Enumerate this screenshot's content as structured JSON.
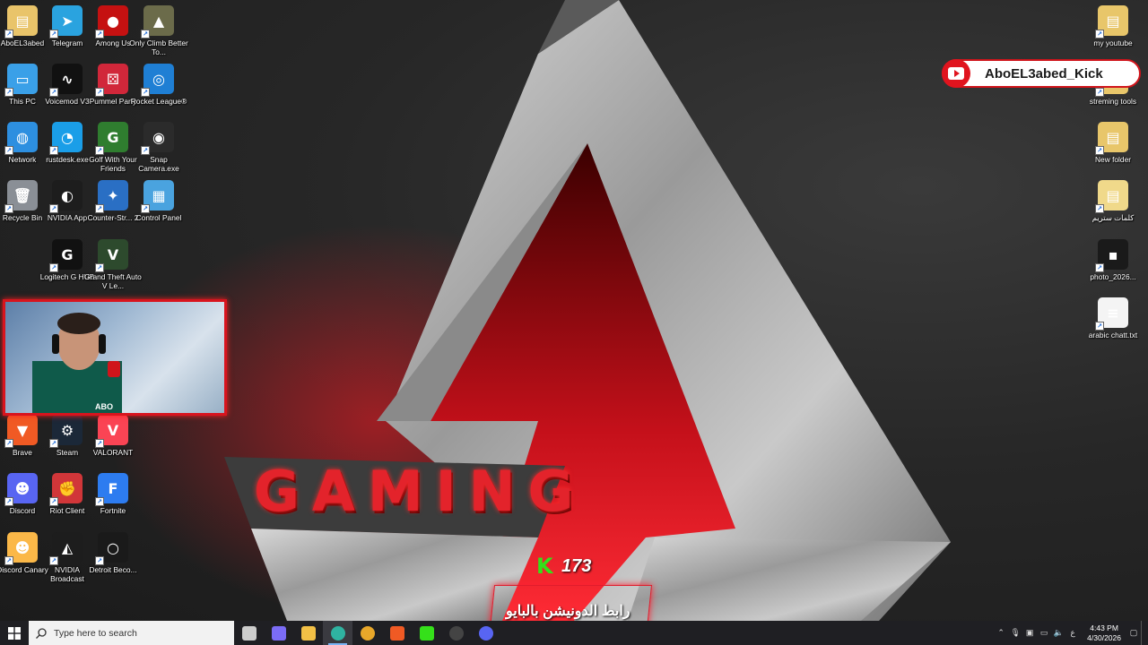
{
  "desktop_icons_left": [
    {
      "label": "AboEL3abed",
      "icon": "user-folder-icon",
      "color": "#e9c46a",
      "glyph": "▤"
    },
    {
      "label": "Telegram",
      "icon": "telegram-icon",
      "color": "#2aa3df",
      "glyph": "➤"
    },
    {
      "label": "Among Us",
      "icon": "among-us-icon",
      "color": "#c51111",
      "glyph": "●"
    },
    {
      "label": "Only Climb Better To...",
      "icon": "only-climb-icon",
      "color": "#6b6b4a",
      "glyph": "▲"
    },
    {
      "label": "This PC",
      "icon": "this-pc-icon",
      "color": "#3aa0e8",
      "glyph": "▭"
    },
    {
      "label": "Voicemod V3",
      "icon": "voicemod-icon",
      "color": "#111111",
      "glyph": "∿"
    },
    {
      "label": "Pummel Party",
      "icon": "pummel-party-icon",
      "color": "#d1273a",
      "glyph": "⚄"
    },
    {
      "label": "Rocket League®",
      "icon": "rocket-league-icon",
      "color": "#1f7fd4",
      "glyph": "◎"
    },
    {
      "label": "Network",
      "icon": "network-icon",
      "color": "#2d8fe0",
      "glyph": "◍"
    },
    {
      "label": "rustdesk.exe",
      "icon": "rustdesk-icon",
      "color": "#1a9ee8",
      "glyph": "◔"
    },
    {
      "label": "Golf With Your Friends",
      "icon": "golf-icon",
      "color": "#2f7d2f",
      "glyph": "G"
    },
    {
      "label": "Snap Camera.exe",
      "icon": "snap-camera-icon",
      "color": "#2b2b2b",
      "glyph": "◉"
    },
    {
      "label": "Recycle Bin",
      "icon": "recycle-bin-icon",
      "color": "#8a8f96",
      "glyph": "🗑"
    },
    {
      "label": "NVIDIA App",
      "icon": "nvidia-icon",
      "color": "#1d1d1d",
      "glyph": "◐"
    },
    {
      "label": "Counter-Str... 2",
      "icon": "counter-strike-icon",
      "color": "#2a6fc4",
      "glyph": "✦"
    },
    {
      "label": "Control Panel",
      "icon": "control-panel-icon",
      "color": "#4aa3df",
      "glyph": "▦"
    },
    {
      "label": "Logitech G HUB",
      "icon": "logitech-icon",
      "color": "#111111",
      "glyph": "G"
    },
    {
      "label": "Grand Theft Auto V Le...",
      "icon": "gta-v-icon",
      "color": "#2d4a2d",
      "glyph": "V"
    },
    {
      "label": "Brave",
      "icon": "brave-icon",
      "color": "#f05a24",
      "glyph": "▼"
    },
    {
      "label": "Steam",
      "icon": "steam-icon",
      "color": "#1b2838",
      "glyph": "⚙"
    },
    {
      "label": "VALORANT",
      "icon": "valorant-icon",
      "color": "#fa4454",
      "glyph": "V"
    },
    {
      "label": "Discord",
      "icon": "discord-icon",
      "color": "#5865f2",
      "glyph": "☻"
    },
    {
      "label": "Riot Client",
      "icon": "riot-client-icon",
      "color": "#d13639",
      "glyph": "✊"
    },
    {
      "label": "Fortnite",
      "icon": "fortnite-icon",
      "color": "#2d7cf0",
      "glyph": "F"
    },
    {
      "label": "Discord Canary",
      "icon": "discord-canary-icon",
      "color": "#fbb848",
      "glyph": "☻"
    },
    {
      "label": "NVIDIA Broadcast",
      "icon": "nvidia-broadcast-icon",
      "color": "#1d1d1d",
      "glyph": "◭"
    },
    {
      "label": "Detroit Beco...",
      "icon": "detroit-icon",
      "color": "#1a1a1a",
      "glyph": "○"
    }
  ],
  "desktop_icons_right": [
    {
      "label": "my youtube",
      "icon": "folder-icon",
      "color": "#e8c66a",
      "glyph": "▤"
    },
    {
      "label": "streming tools",
      "icon": "folder-icon",
      "color": "#e8c66a",
      "glyph": "▤"
    },
    {
      "label": "New folder",
      "icon": "folder-icon",
      "color": "#e8c66a",
      "glyph": "▤"
    },
    {
      "label": "كلمات ستريم",
      "icon": "folder-icon",
      "color": "#f0d98a",
      "glyph": "▤"
    },
    {
      "label": "photo_2026...",
      "icon": "photo-file-icon",
      "color": "#1a1a1a",
      "glyph": "▪"
    },
    {
      "label": "arabic chatt.txt",
      "icon": "text-file-icon",
      "color": "#f4f4f4",
      "glyph": "≡"
    }
  ],
  "wallpaper": {
    "brand_text": "GAMING",
    "accent": "#e3232b"
  },
  "webcam": {
    "label": "ABO"
  },
  "kick_banner": {
    "text": "AboEL3abed_Kick"
  },
  "kick_counter": {
    "count": "173"
  },
  "donation_text": "رابط الدونيشن بالبايو",
  "taskbar": {
    "search_placeholder": "Type here to search",
    "apps": [
      {
        "name": "task-view",
        "color": "#cccccc"
      },
      {
        "name": "copilot",
        "color": "#7b6cf6"
      },
      {
        "name": "file-explorer",
        "color": "#f2c046"
      },
      {
        "name": "edge",
        "color": "#2fb3a1",
        "active": true
      },
      {
        "name": "chrome",
        "color": "#e8a72a"
      },
      {
        "name": "brave",
        "color": "#f05a24"
      },
      {
        "name": "kick-app",
        "color": "#35e01a"
      },
      {
        "name": "obs",
        "color": "#444444"
      },
      {
        "name": "discord",
        "color": "#5865f2"
      }
    ],
    "language": "ع",
    "time": "4:43 PM",
    "date": "4/30/2026"
  }
}
